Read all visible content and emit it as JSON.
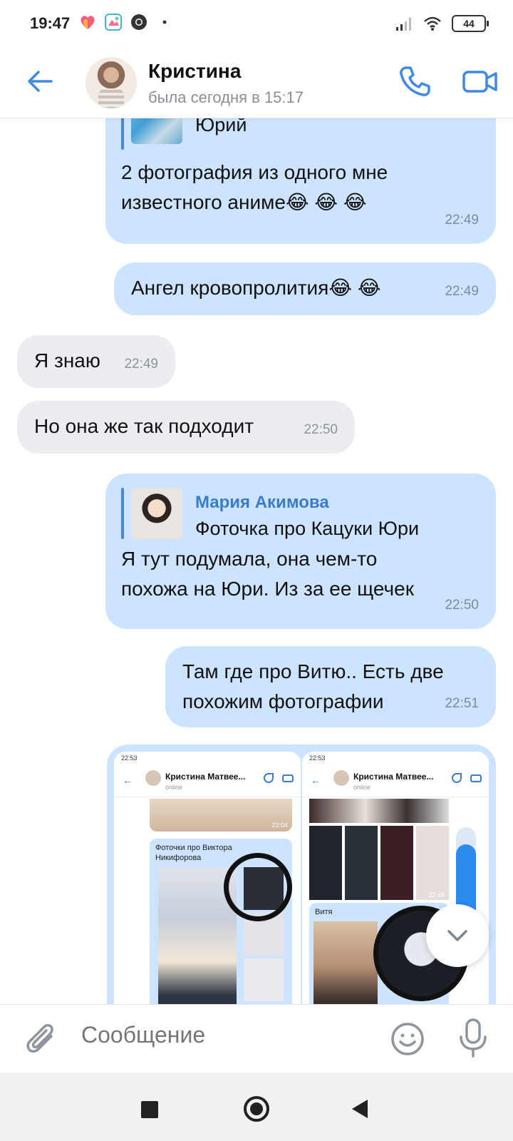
{
  "status_bar": {
    "time": "19:47",
    "battery": "44",
    "left_icons": [
      "heart-app-icon",
      "photo-app-icon",
      "chrome-icon",
      "dot-icon"
    ],
    "right_icons": [
      "signal-icon",
      "wifi-icon",
      "battery-icon"
    ]
  },
  "header": {
    "name": "Кристина",
    "status": "была сегодня в 15:17",
    "back_icon": "arrow-left-icon",
    "call_icon": "phone-icon",
    "video_icon": "video-camera-icon",
    "accent": "#3f8ae0"
  },
  "messages": [
    {
      "direction": "out",
      "reply": {
        "author": "",
        "text": "Юрий"
      },
      "text_lines": [
        "2 фотография из одного мне",
        "известного аниме😂 😂 😂"
      ],
      "time": "22:49"
    },
    {
      "direction": "out",
      "text": "Ангел кровопролития😂 😂",
      "time": "22:49"
    },
    {
      "direction": "in",
      "text": "Я знаю",
      "time": "22:49"
    },
    {
      "direction": "in",
      "text": "Но она же так подходит",
      "time": "22:50"
    },
    {
      "direction": "out",
      "reply": {
        "author": "Мария Акимова",
        "text": "Фоточка про Кацуки Юри"
      },
      "text_lines": [
        "Я тут подумала, она чем-то",
        "похожа на Юри. Из за ее щечек"
      ],
      "time": "22:50"
    },
    {
      "direction": "out",
      "text_lines": [
        "Там где про Витю.. Есть две",
        "похожим фотографии"
      ],
      "time": "22:51"
    }
  ],
  "media": {
    "screenshots": [
      {
        "status_time": "22:53",
        "contact": "Кристина Матвее...",
        "online": "online",
        "top_time": "22:04",
        "caption": "Фоточки про Виктора Никифорова"
      },
      {
        "status_time": "22:53",
        "contact": "Кристина Матвее...",
        "online": "online",
        "top_time": "22:48",
        "caption": "Витя"
      }
    ]
  },
  "composer": {
    "placeholder": "Сообщение",
    "attach_icon": "paperclip-icon",
    "emoji_icon": "smiley-icon",
    "mic_icon": "microphone-icon"
  },
  "scroll_down_icon": "chevron-down-icon",
  "nav": {
    "recent_icon": "square-icon",
    "home_icon": "circle-icon",
    "back_icon": "triangle-back-icon"
  },
  "colors": {
    "outgoing": "#cce4ff",
    "incoming": "#ebedf0",
    "link": "#3b7cc6"
  }
}
